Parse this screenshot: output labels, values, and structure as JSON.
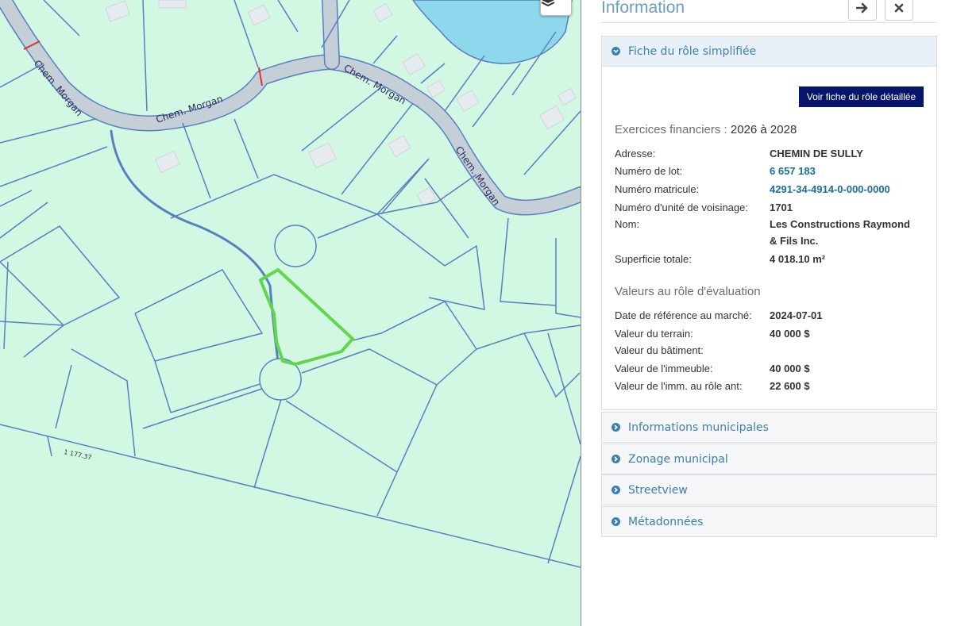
{
  "map": {
    "street_label": "Chem. Morgan",
    "measurement_label": "1 177.37",
    "layers_icon": "layers-icon",
    "colors": {
      "land": "#d2f7e2",
      "parcel_line": "#5a7fc0",
      "road": "#c4cfd8",
      "water": "#8ed8ee",
      "selected_parcel": "#63d64f",
      "building": "#e6ebef"
    }
  },
  "panel": {
    "title": "Information",
    "forward_icon": "arrow-right-icon",
    "close_icon": "close-icon",
    "fiche": {
      "header": "Fiche du rôle simplifiée",
      "detail_button": "Voir fiche du rôle détaillée",
      "exercices_label": "Exercices financiers :",
      "exercices_value": "2026 à 2028",
      "rows": [
        {
          "label": "Adresse:",
          "value": "CHEMIN DE SULLY"
        },
        {
          "label": "Numéro de lot:",
          "value": "6 657 183"
        },
        {
          "label": "Numéro matricule:",
          "value": "4291-34-4914-0-000-0000"
        },
        {
          "label": "Numéro d'unité de voisinage:",
          "value": "1701"
        },
        {
          "label": "Nom:",
          "value": "Les Constructions Raymond",
          "value_line2": "& Fils Inc."
        },
        {
          "label": "Superficie totale:",
          "value": "4 018.10 m²"
        }
      ],
      "valeurs_title": "Valeurs au rôle d'évaluation",
      "valeurs": [
        {
          "label": "Date de référence au marché:",
          "value": "2024-07-01"
        },
        {
          "label": "Valeur du terrain:",
          "value": "40 000 $"
        },
        {
          "label": "Valeur du bâtiment:",
          "value": ""
        },
        {
          "label": "Valeur de l'immeuble:",
          "value": "40 000 $"
        },
        {
          "label": "Valeur de l'imm. au rôle ant:",
          "value": "22 600 $"
        }
      ]
    },
    "sections": [
      {
        "label": "Informations municipales"
      },
      {
        "label": "Zonage municipal"
      },
      {
        "label": "Streetview"
      },
      {
        "label": "Métadonnées"
      }
    ],
    "colors": {
      "title": "#6aa0bf",
      "link": "#1a6e9c",
      "button": "#07166b"
    }
  }
}
